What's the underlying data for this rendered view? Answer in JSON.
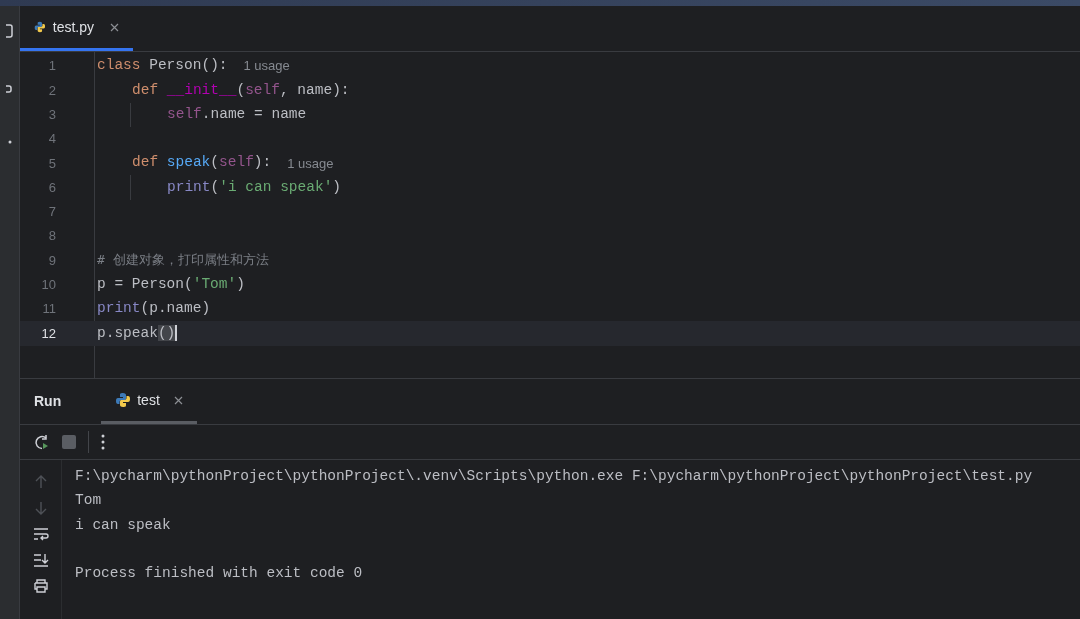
{
  "editor_tabs": [
    {
      "label": "test.py",
      "selected": true
    }
  ],
  "editor": {
    "lines": [
      {
        "number": "1",
        "current": false,
        "tokens": [
          {
            "text": "class",
            "kind": "keyword"
          },
          {
            "text": " Person():",
            "kind": "plain"
          }
        ],
        "hint": "1 usage",
        "children": [
          {
            "number": "2",
            "current": false,
            "tokens": [
              {
                "text": "def",
                "kind": "keyword"
              },
              {
                "text": " __init__",
                "kind": "magic"
              },
              {
                "text": "(",
                "kind": "plain"
              },
              {
                "text": "self",
                "kind": "self"
              },
              {
                "text": ", name):",
                "kind": "plain"
              }
            ],
            "children": [
              {
                "number": "3",
                "current": false,
                "tokens": [
                  {
                    "text": "self",
                    "kind": "self"
                  },
                  {
                    "text": ".name = name",
                    "kind": "plain"
                  }
                ]
              }
            ]
          },
          {
            "number": "4",
            "current": false
          },
          {
            "number": "5",
            "current": false,
            "tokens": [
              {
                "text": "def",
                "kind": "keyword"
              },
              {
                "text": " speak",
                "kind": "function"
              },
              {
                "text": "(",
                "kind": "plain"
              },
              {
                "text": "self",
                "kind": "self"
              },
              {
                "text": "):",
                "kind": "plain"
              }
            ],
            "hint": "1 usage",
            "children": [
              {
                "number": "6",
                "current": false,
                "tokens": [
                  {
                    "text": "print",
                    "kind": "builtin"
                  },
                  {
                    "text": "(",
                    "kind": "plain"
                  },
                  {
                    "text": "'i can speak'",
                    "kind": "string"
                  },
                  {
                    "text": ")",
                    "kind": "plain"
                  }
                ]
              }
            ]
          }
        ]
      },
      {
        "number": "7",
        "current": false
      },
      {
        "number": "8",
        "current": false
      },
      {
        "number": "9",
        "current": false,
        "tokens": [
          {
            "text": "# 创建对象，打印属性和方法",
            "kind": "comment"
          }
        ]
      },
      {
        "number": "10",
        "current": false,
        "tokens": [
          {
            "text": "p = Person(",
            "kind": "plain"
          },
          {
            "text": "'Tom'",
            "kind": "string"
          },
          {
            "text": ")",
            "kind": "plain"
          }
        ]
      },
      {
        "number": "11",
        "current": false,
        "tokens": [
          {
            "text": "print",
            "kind": "builtin"
          },
          {
            "text": "(p.name)",
            "kind": "plain"
          }
        ]
      },
      {
        "number": "12",
        "current": true,
        "tokens": [
          {
            "text": "p.speak",
            "kind": "plain"
          },
          {
            "text": "()",
            "kind": "brace-match"
          }
        ]
      }
    ]
  },
  "run_panel": {
    "title": "Run",
    "tabs": [
      {
        "label": "test",
        "selected": true
      }
    ],
    "output": [
      "F:\\pycharm\\pythonProject\\pythonProject\\.venv\\Scripts\\python.exe F:\\pycharm\\pythonProject\\pythonProject\\test.py",
      "Tom",
      "i can speak"
    ],
    "exit_message": "Process finished with exit code 0",
    "side_tools": [
      {
        "kind": "up",
        "disabled": true
      },
      {
        "kind": "down",
        "disabled": true
      },
      {
        "kind": "wrap",
        "disabled": false
      },
      {
        "kind": "scroll-end",
        "disabled": false
      },
      {
        "kind": "print",
        "disabled": false
      }
    ]
  }
}
